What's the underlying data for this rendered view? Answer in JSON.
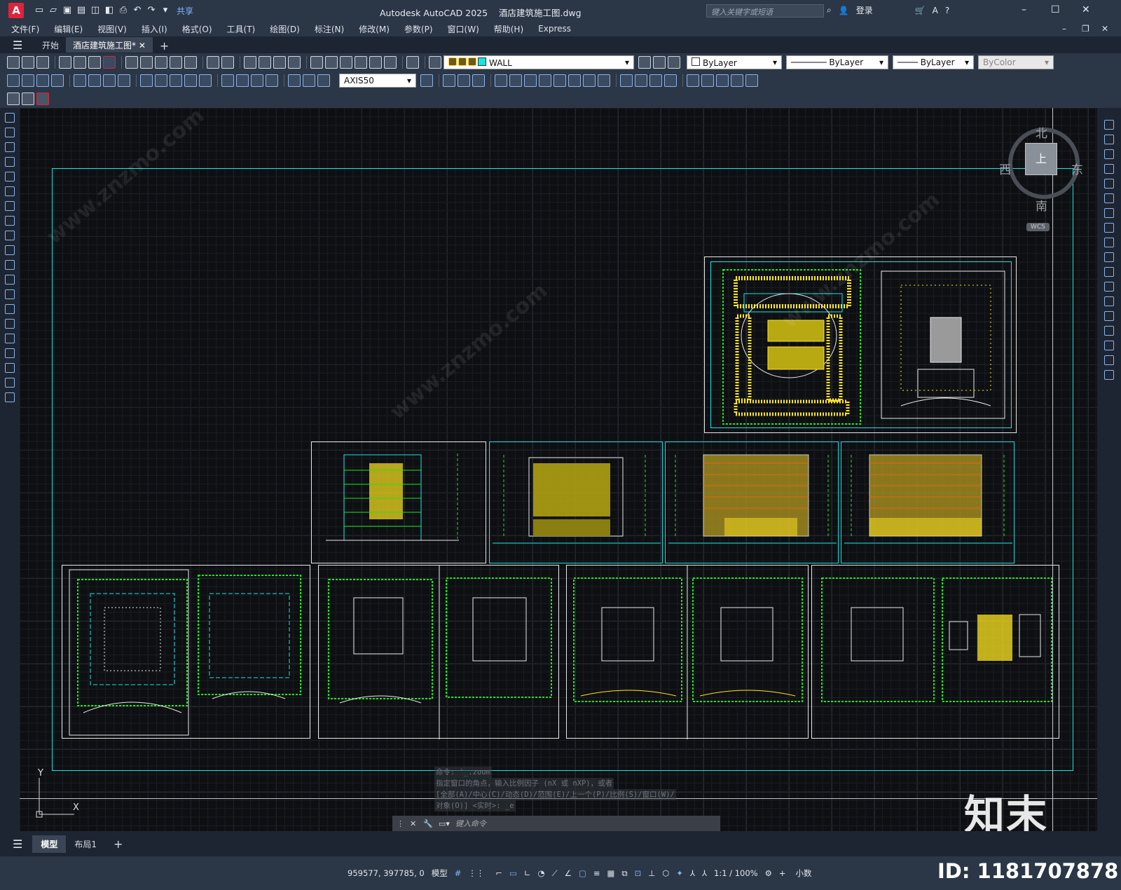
{
  "app": {
    "logo": "A",
    "title": "Autodesk AutoCAD 2025",
    "file": "酒店建筑施工图.dwg",
    "share": "共享",
    "search_placeholder": "键入关键字或短语",
    "login": "登录"
  },
  "menu": [
    "文件(F)",
    "编辑(E)",
    "视图(V)",
    "插入(I)",
    "格式(O)",
    "工具(T)",
    "绘图(D)",
    "标注(N)",
    "修改(M)",
    "参数(P)",
    "窗口(W)",
    "帮助(H)",
    "Express"
  ],
  "doc_tabs": [
    "开始",
    "酒店建筑施工图*"
  ],
  "layer": {
    "name": "WALL",
    "color_prop": "ByLayer",
    "linetype": "ByLayer",
    "lineweight": "ByLayer",
    "plotstyle": "ByColor",
    "dimstyle": "AXIS50"
  },
  "viewcube": {
    "north": "北",
    "south": "南",
    "east": "东",
    "west": "西",
    "top": "上",
    "wcs": "WCS"
  },
  "ucs": {
    "x": "X",
    "y": "Y"
  },
  "command_history": [
    "命令: '_.zoom",
    "指定窗口的角点，输入比例因子 (nX 或 nXP)，或者",
    "[全部(A)/中心(C)/动态(D)/范围(E)/上一个(P)/比例(S)/窗口(W)/",
    "对象(O)] <实时>: _e"
  ],
  "command_placeholder": "键入命令",
  "layout_tabs": [
    "模型",
    "布局1"
  ],
  "status": {
    "coords": "959577, 397785, 0",
    "space": "模型",
    "scale": "1:1 / 100%",
    "units": "小数"
  },
  "watermark": {
    "brand": "知末",
    "id": "ID: 1181707878",
    "site": "www.znzmo.com"
  },
  "colors": {
    "accent_red": "#e0223a",
    "drawing_green": "#19e61e",
    "drawing_cyan": "#19e3e3",
    "drawing_yellow": "#ffe620"
  }
}
